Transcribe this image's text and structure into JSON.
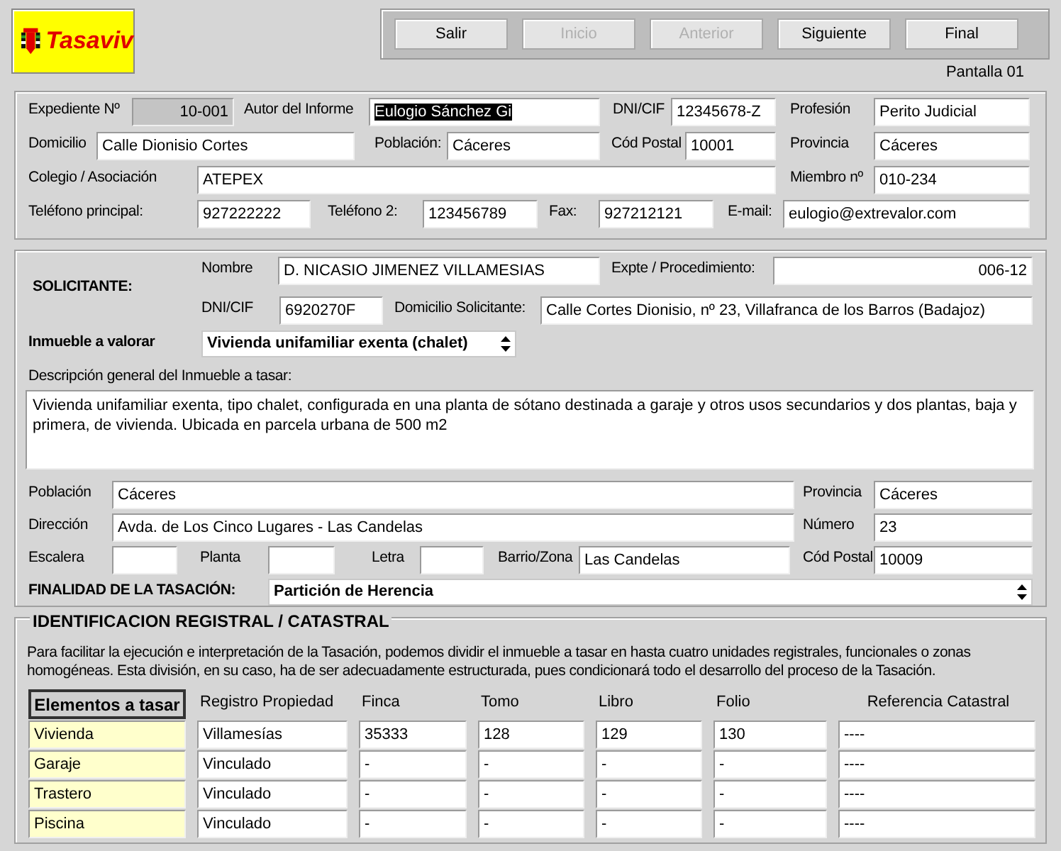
{
  "logo": {
    "text": "Tasaviv"
  },
  "nav": {
    "buttons": [
      {
        "label": "Salir",
        "disabled": false
      },
      {
        "label": "Inicio",
        "disabled": true
      },
      {
        "label": "Anterior",
        "disabled": true
      },
      {
        "label": "Siguiente",
        "disabled": false
      },
      {
        "label": "Final",
        "disabled": false
      }
    ],
    "screen": "Pantalla 01"
  },
  "perito": {
    "fields": [
      {
        "label": "Expediente Nº",
        "value": "10-001",
        "kind": "readonly"
      },
      {
        "label": "Autor del Informe",
        "value": "Eulogio Sánchez Gi",
        "kind": "selected"
      },
      {
        "label": "DNI/CIF",
        "value": "12345678-Z",
        "kind": "text"
      },
      {
        "label": "Profesión",
        "value": "Perito Judicial",
        "kind": "text"
      },
      {
        "label": "Domicilio",
        "value": "Calle Dionisio Cortes",
        "kind": "text"
      },
      {
        "label": "Población:",
        "value": "Cáceres",
        "kind": "text"
      },
      {
        "label": "Cód Postal",
        "value": "10001",
        "kind": "text"
      },
      {
        "label": "Provincia",
        "value": "Cáceres",
        "kind": "text"
      },
      {
        "label": "Colegio / Asociación",
        "value": "ATEPEX",
        "kind": "text"
      },
      {
        "label": "Miembro nº",
        "value": "010-234",
        "kind": "text"
      },
      {
        "label": "Teléfono principal:",
        "value": "927222222",
        "kind": "text"
      },
      {
        "label": "Teléfono 2:",
        "value": "123456789",
        "kind": "text"
      },
      {
        "label": "Fax:",
        "value": "927212121",
        "kind": "text"
      },
      {
        "label": "E-mail:",
        "value": "eulogio@extrevalor.com",
        "kind": "text"
      }
    ]
  },
  "solicitante": {
    "title": "SOLICITANTE:",
    "fields": [
      {
        "label": "Nombre",
        "value": "D. NICASIO JIMENEZ VILLAMESIAS",
        "kind": "text"
      },
      {
        "label": "Expte / Procedimiento:",
        "value": "006-12",
        "kind": "right"
      },
      {
        "label": "DNI/CIF",
        "value": "6920270F",
        "kind": "text"
      },
      {
        "label": "Domicilio Solicitante:",
        "value": "Calle Cortes Dionisio, nº 23, Villafranca de los Barros  (Badajoz)",
        "kind": "text"
      }
    ]
  },
  "inmueble": {
    "label": "Inmueble a valorar",
    "value": "Vivienda unifamiliar exenta (chalet)"
  },
  "descripcion": {
    "label": "Descripción general del Inmueble a tasar:",
    "value": "Vivienda unifamiliar exenta, tipo chalet, configurada en una planta de sótano destinada a garaje y otros usos secundarios y dos plantas, baja y primera, de vivienda. Ubicada en parcela urbana de 500 m2"
  },
  "ubicacion": {
    "fields": [
      {
        "label": "Población",
        "value": "Cáceres",
        "kind": "text"
      },
      {
        "label": "Provincia",
        "value": "Cáceres",
        "kind": "text"
      },
      {
        "label": "Dirección",
        "value": "Avda. de Los Cinco Lugares - Las Candelas",
        "kind": "text"
      },
      {
        "label": "Número",
        "value": "23",
        "kind": "text"
      },
      {
        "label": "Escalera",
        "kind": "text"
      },
      {
        "label": "Planta",
        "kind": "text"
      },
      {
        "label": "Letra",
        "kind": "text"
      },
      {
        "label": "Barrio/Zona",
        "value": "Las Candelas",
        "kind": "text"
      },
      {
        "label": "Cód Postal",
        "value": "10009",
        "kind": "text"
      }
    ]
  },
  "finalidad": {
    "label": "FINALIDAD DE LA TASACIÓN:",
    "value": "Partición de Herencia"
  },
  "registral": {
    "title": "IDENTIFICACION REGISTRAL / CATASTRAL",
    "note": "Para facilitar la ejecución e interpretación de la Tasación, podemos dividir el inmueble a tasar en hasta cuatro unidades registrales, funcionales o zonas homogéneas. Esta división, en su caso, ha de ser adecuadamente estructurada, pues condicionará todo el desarrollo del proceso de la Tasación.",
    "columns": [
      "Elementos a tasar",
      "Registro Propiedad",
      "Finca",
      "Tomo",
      "Libro",
      "Folio",
      "Referencia Catastral"
    ],
    "rows": [
      [
        "Vivienda",
        "Villamesías",
        "35333",
        "128",
        "129",
        "130",
        "----"
      ],
      [
        "Garaje",
        "Vinculado",
        "-",
        "-",
        "-",
        "-",
        "----"
      ],
      [
        "Trastero",
        "Vinculado",
        "-",
        "-",
        "-",
        "-",
        "----"
      ],
      [
        "Piscina",
        "Vinculado",
        "-",
        "-",
        "-",
        "-",
        "----"
      ]
    ]
  }
}
